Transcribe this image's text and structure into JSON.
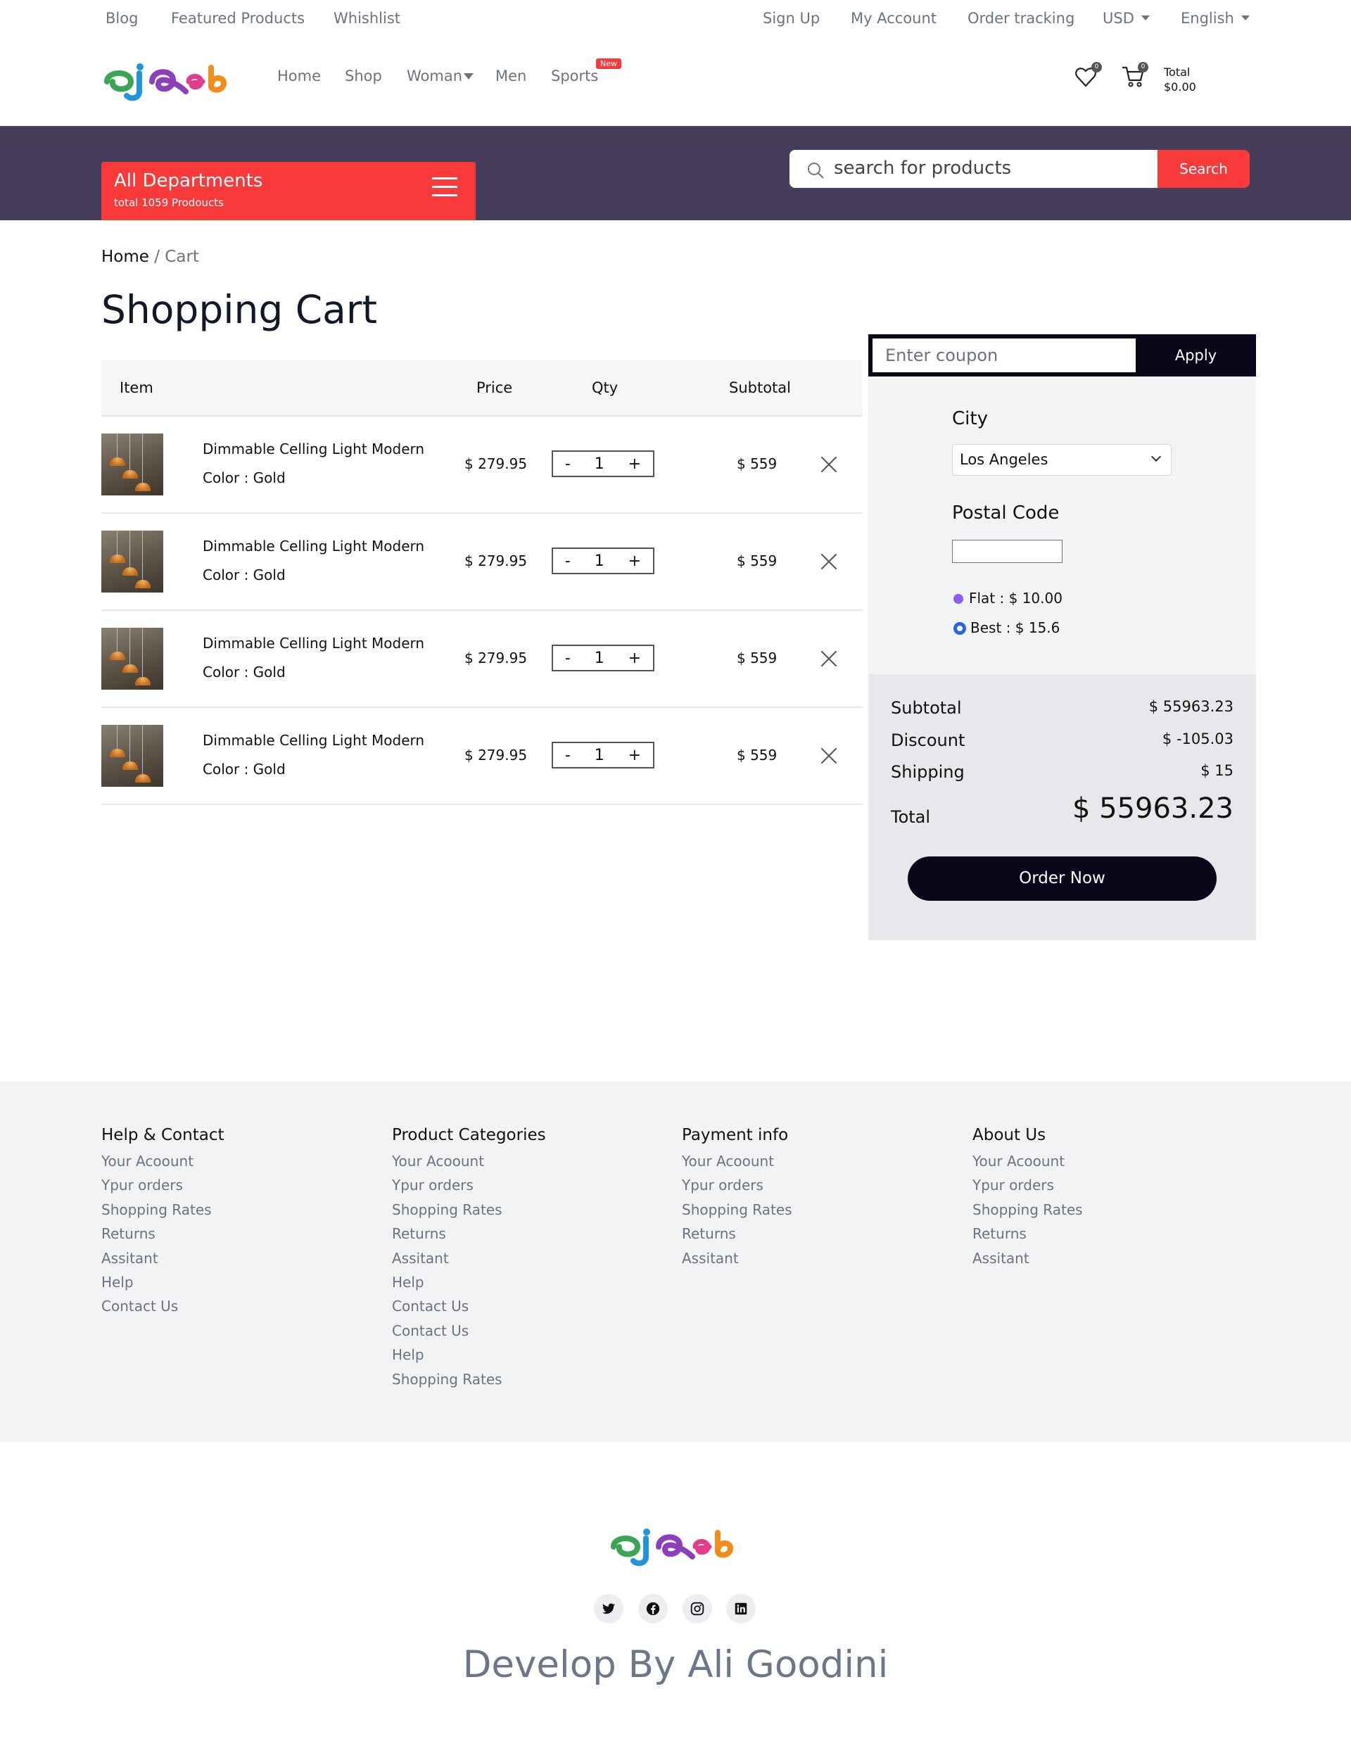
{
  "topbar": {
    "left_links": [
      "Blog",
      "Featured Products",
      "Whishlist"
    ],
    "right_links": [
      "Sign Up",
      "My Account",
      "Order tracking"
    ],
    "currency": "USD",
    "language": "English"
  },
  "header": {
    "nav": [
      "Home",
      "Shop",
      "Woman",
      "Men",
      "Sports"
    ],
    "new_badge": "New",
    "wishlist_count": "0",
    "cart_count": "0",
    "total_label": "Total",
    "total_value": "$0.00"
  },
  "departments": {
    "title": "All Departments",
    "subtitle": "total 1059 Prodoucts"
  },
  "search": {
    "placeholder": "search for products",
    "button": "Search"
  },
  "breadcrumb": {
    "home": "Home",
    "sep": "/",
    "current": "Cart"
  },
  "page_title": "Shopping Cart",
  "table": {
    "headers": {
      "item": "Item",
      "price": "Price",
      "qty": "Qty",
      "subtotal": "Subtotal"
    },
    "rows": [
      {
        "name": "Dimmable Celling Light Modern",
        "color": "Color : Gold",
        "price": "$ 279.95",
        "qty": "1",
        "subtotal": "$ 559"
      },
      {
        "name": "Dimmable Celling Light Modern",
        "color": "Color : Gold",
        "price": "$ 279.95",
        "qty": "1",
        "subtotal": "$ 559"
      },
      {
        "name": "Dimmable Celling Light Modern",
        "color": "Color : Gold",
        "price": "$ 279.95",
        "qty": "1",
        "subtotal": "$ 559"
      },
      {
        "name": "Dimmable Celling Light Modern",
        "color": "Color : Gold",
        "price": "$ 279.95",
        "qty": "1",
        "subtotal": "$ 559"
      }
    ],
    "minus": "-",
    "plus": "+"
  },
  "coupon": {
    "placeholder": "Enter coupon",
    "button": "Apply"
  },
  "shipping": {
    "city_label": "City",
    "city_value": "Los Angeles",
    "postal_label": "Postal Code",
    "postal_value": "",
    "options": [
      "Flat : $ 10.00",
      "Best : $ 15.6"
    ],
    "selected_option": "Best : $ 15.6"
  },
  "summary": {
    "subtotal_label": "Subtotal",
    "subtotal_value": "$ 55963.23",
    "discount_label": "Discount",
    "discount_value": "$ -105.03",
    "shipping_label": "Shipping",
    "shipping_value": "$ 15",
    "total_label": "Total",
    "total_value": "$ 55963.23",
    "order_button": "Order Now"
  },
  "footer": {
    "columns": [
      {
        "title": "Help & Contact",
        "links": [
          "Your Acoount",
          "Ypur orders",
          "Shopping Rates",
          "Returns",
          "Assitant",
          "Help",
          "Contact Us"
        ]
      },
      {
        "title": "Product Categories",
        "links": [
          "Your Acoount",
          "Ypur orders",
          "Shopping Rates",
          "Returns",
          "Assitant",
          "Help",
          "Contact Us",
          "Contact Us",
          "Help",
          "Shopping Rates"
        ]
      },
      {
        "title": "Payment info",
        "links": [
          "Your Acoount",
          "Ypur orders",
          "Shopping Rates",
          "Returns",
          "Assitant"
        ]
      },
      {
        "title": "About Us",
        "links": [
          "Your Acoount",
          "Ypur orders",
          "Shopping Rates",
          "Returns",
          "Assitant"
        ]
      }
    ],
    "social_icons": [
      "twitter-icon",
      "facebook-icon",
      "instagram-icon",
      "linkedin-icon"
    ],
    "credit": "Develop By Ali Goodini"
  },
  "colors": {
    "accent_red": "#f83a3a",
    "hero_purple": "#463d5c",
    "dark": "#0b0619",
    "radio_flat": "#8b5cf6",
    "radio_best": "#2563eb"
  }
}
